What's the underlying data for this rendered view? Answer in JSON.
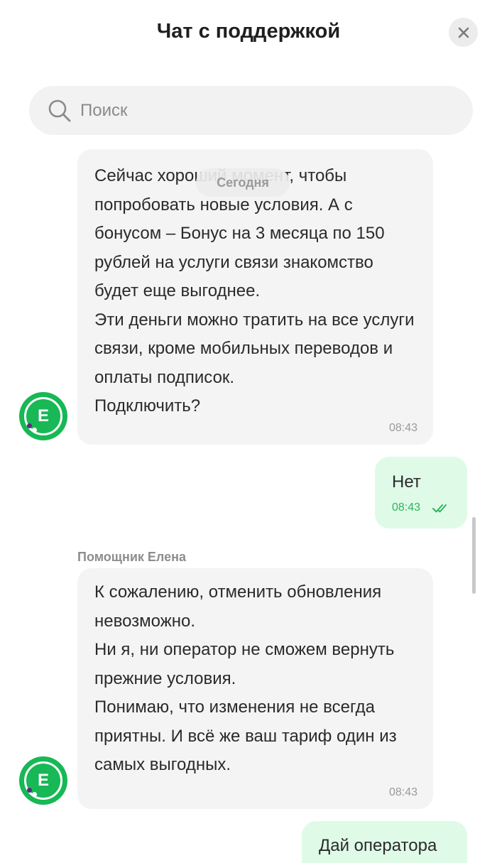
{
  "header": {
    "title": "Чат с поддержкой"
  },
  "search": {
    "placeholder": "Поиск"
  },
  "chat": {
    "date_label": "Сегодня",
    "messages": [
      {
        "side": "in",
        "lines": [
          "Сейчас хороший момент, чтобы попробовать новые условия. А с бонусом – Бонус на 3 месяца по 150 рублей на услуги связи знакомство будет еще выгоднее.",
          "Эти деньги можно тратить на все услуги связи, кроме мобильных переводов и оплаты подписок.",
          "Подключить?"
        ],
        "time": "08:43"
      },
      {
        "side": "out",
        "text": "Нет",
        "time": "08:43",
        "status": "read"
      },
      {
        "side": "in",
        "sender": "Помощник Елена",
        "lines": [
          "К сожалению, отменить обновления невозможно.",
          "Ни я, ни оператор не сможем вернуть прежние условия.",
          "Понимаю, что изменения не всегда приятны. И всё же ваш тариф один из самых выгодных."
        ],
        "time": "08:43"
      },
      {
        "side": "out",
        "text": "Дай оператора"
      }
    ]
  },
  "avatar": {
    "letter": "E"
  },
  "colors": {
    "brand_green": "#17b855",
    "outgoing_bubble": "#dffbe8",
    "incoming_bubble": "#f4f4f4",
    "read_check": "#2bb55a"
  },
  "icons": {
    "close": "close-icon",
    "search": "search-icon",
    "read_status": "double-check-icon"
  }
}
